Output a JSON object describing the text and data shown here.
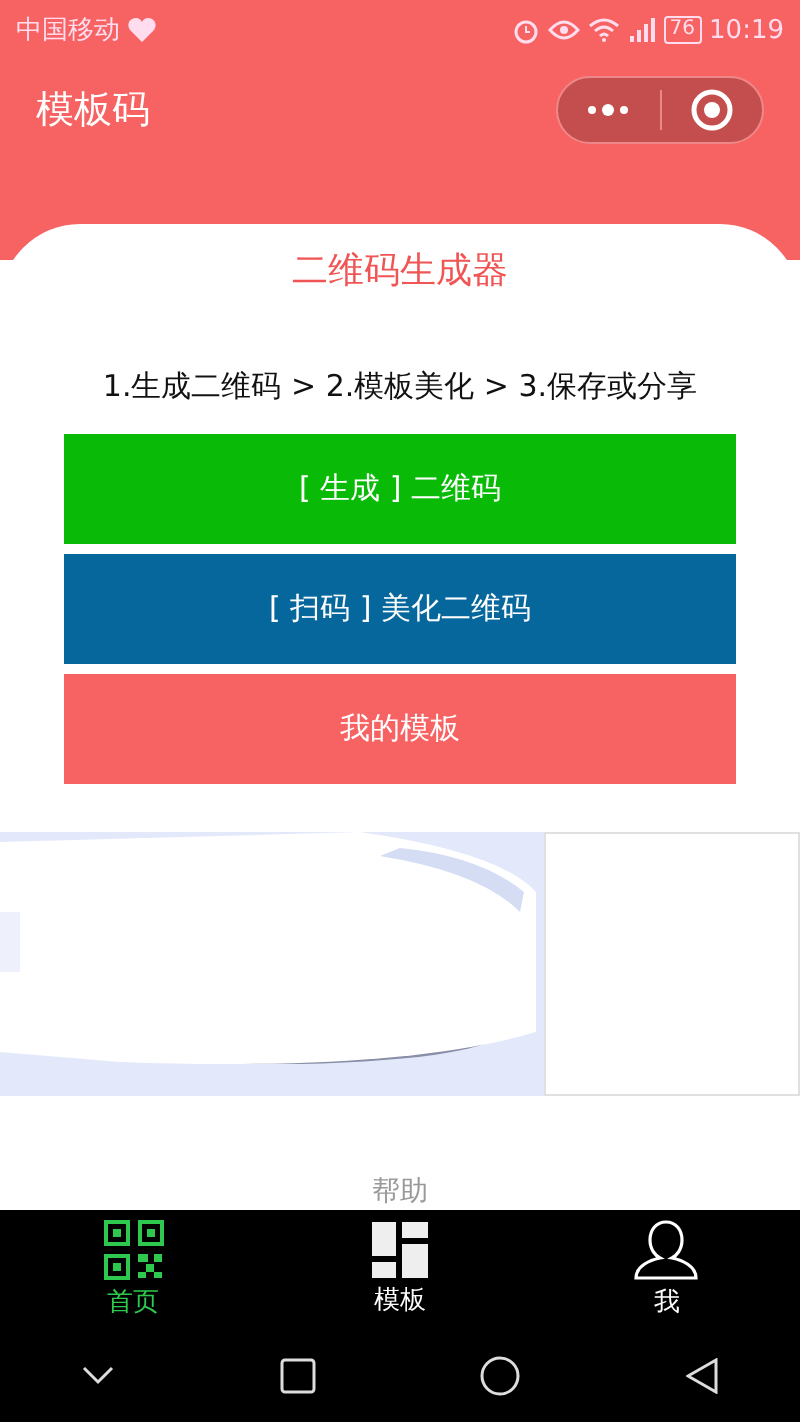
{
  "status_bar": {
    "carrier": "中国移动",
    "battery": "76",
    "time": "10:19"
  },
  "nav": {
    "title": "模板码"
  },
  "card": {
    "title": "二维码生成器",
    "steps": "1.生成二维码 > 2.模板美化 > 3.保存或分享"
  },
  "actions": [
    {
      "label": "[ 生成 ] 二维码",
      "color": "#09bb07"
    },
    {
      "label": "[ 扫码 ] 美化二维码",
      "color": "#05679c"
    },
    {
      "label": "我的模板",
      "color": "#f76363"
    }
  ],
  "help": "帮助",
  "tabs": [
    {
      "label": "首页",
      "kind": "qr",
      "selected": true
    },
    {
      "label": "模板",
      "kind": "grid",
      "selected": false
    },
    {
      "label": "我",
      "kind": "user",
      "selected": false
    }
  ]
}
